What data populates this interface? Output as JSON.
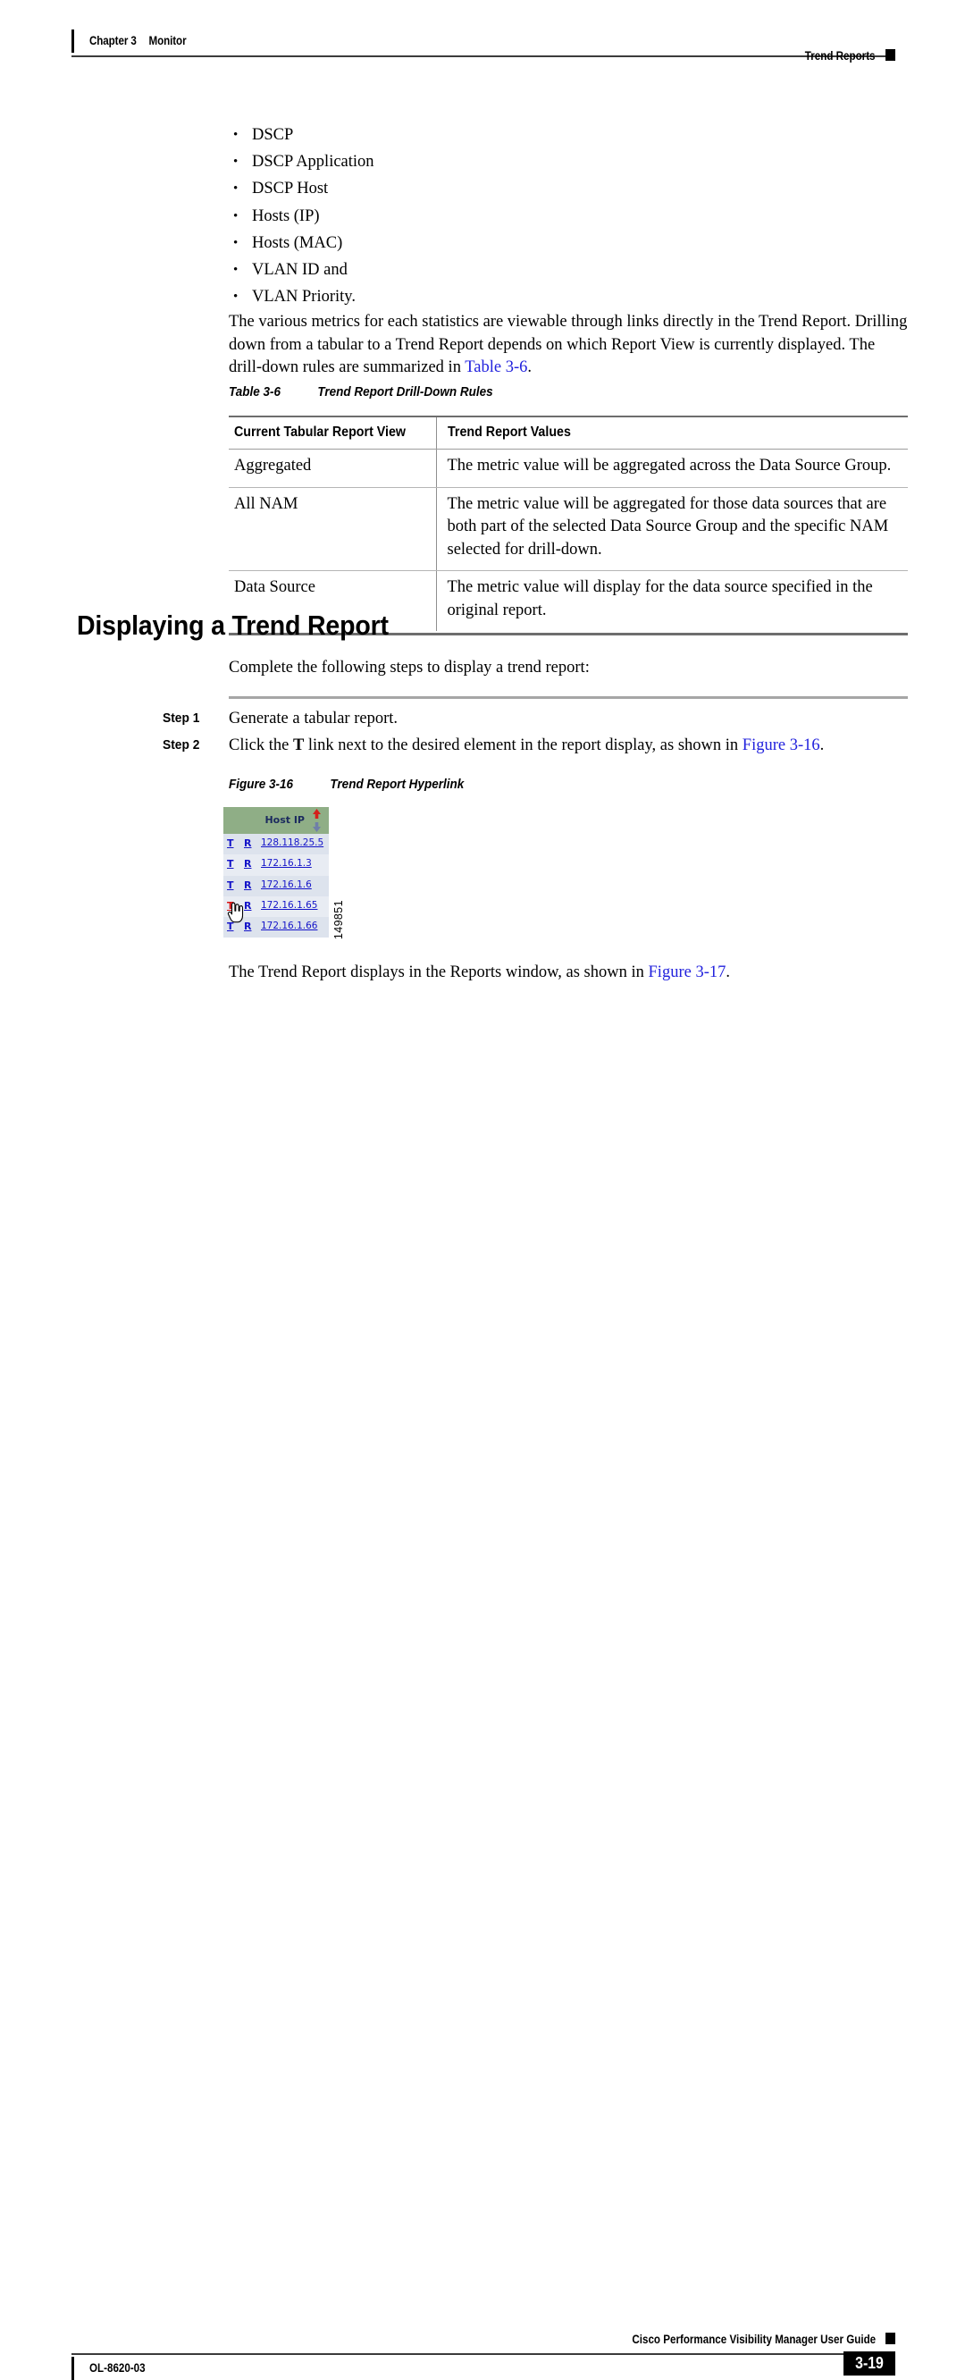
{
  "header": {
    "chapter": "Chapter 3",
    "section": "Monitor",
    "running_head_right": "Trend Reports"
  },
  "bullets": [
    "DSCP",
    "DSCP Application",
    "DSCP Host",
    "Hosts (IP)",
    "Hosts (MAC)",
    "VLAN ID and",
    "VLAN Priority."
  ],
  "paragraphs": {
    "metrics_part1": "The various metrics for each statistics are viewable through links directly in the Trend Report. Drilling down from a tabular to a Trend Report depends on which Report View is currently displayed. The drill-down rules are summarized in ",
    "metrics_xref": "Table 3-6",
    "metrics_part2": ".",
    "complete_steps": "Complete the following steps to display a trend report:",
    "trend_displays_part1": "The Trend Report displays in the Reports window, as shown in ",
    "trend_displays_xref": "Figure 3-17",
    "trend_displays_part2": "."
  },
  "table_3_6": {
    "label": "Table 3-6",
    "title": "Trend Report Drill-Down Rules",
    "columns": [
      "Current Tabular Report View",
      "Trend Report Values"
    ],
    "rows": [
      {
        "view": "Aggregated",
        "value": "The metric value will be aggregated across the Data Source Group."
      },
      {
        "view": "All NAM",
        "value": "The metric value will be aggregated for those data sources that are both part of the selected Data Source Group and the specific NAM selected for drill-down."
      },
      {
        "view": "Data Source",
        "value": "The metric value will display for the data source specified in the original report."
      }
    ]
  },
  "section_heading": "Displaying a Trend Report",
  "steps": [
    {
      "label": "Step 1",
      "text_part1": "Generate a tabular report.",
      "bold": "",
      "text_part2": "",
      "xref": "",
      "text_part3": ""
    },
    {
      "label": "Step 2",
      "text_part1": "Click the ",
      "bold": "T",
      "text_part2": " link next to the desired element in the report display, as shown in ",
      "xref": "Figure 3-16",
      "text_part3": "."
    }
  ],
  "figure_3_16": {
    "label": "Figure 3-16",
    "title": "Trend Report Hyperlink",
    "artwork_number": "149851",
    "colors": {
      "header_green": "#8fae86",
      "row_blue": "#dde3ed",
      "row_blue_alt": "#e8ecf3",
      "link_blue": "#1414c8",
      "hover_red": "#d81212",
      "header_text": "#1b2a5e",
      "sort_asc_arrow": "#d4201c",
      "sort_desc_arrow": "#6f7fa8"
    },
    "table": {
      "header_label": "Host IP",
      "sort_asc_icon": "arrow-up-icon",
      "sort_desc_icon": "arrow-down-icon",
      "trend_link_label": "T",
      "report_link_label": "R",
      "rows": [
        {
          "trend": "T",
          "report": "R",
          "host_ip": "128.118.25.5",
          "hovered": false
        },
        {
          "trend": "T",
          "report": "R",
          "host_ip": "172.16.1.3",
          "hovered": false
        },
        {
          "trend": "T",
          "report": "R",
          "host_ip": "172.16.1.6",
          "hovered": false
        },
        {
          "trend": "T",
          "report": "R",
          "host_ip": "172.16.1.65",
          "hovered": true
        },
        {
          "trend": "T",
          "report": "R",
          "host_ip": "172.16.1.66",
          "hovered": false
        }
      ]
    },
    "cursor_icon": "pointing-hand-cursor-icon"
  },
  "footer": {
    "guide_title": "Cisco Performance Visibility Manager User Guide",
    "doc_id": "OL-8620-03",
    "page_number": "3-19"
  }
}
